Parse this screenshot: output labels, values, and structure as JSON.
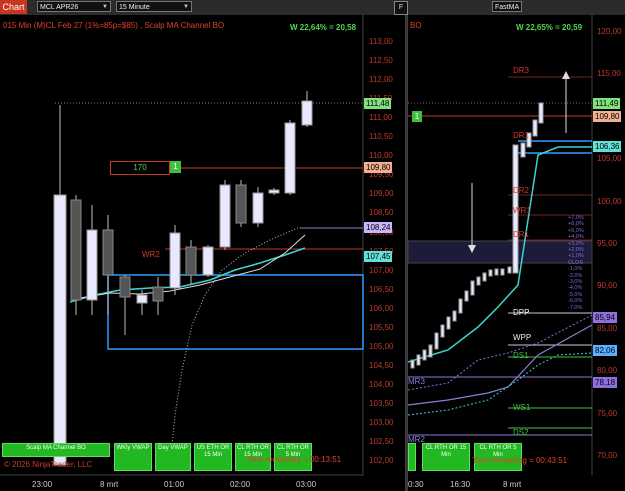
{
  "topbar": {
    "chart_tab": "Chart",
    "instrument": "MCL APR26",
    "interval": "15 Minute",
    "right_tab": "F",
    "right_instrument": "FastMA"
  },
  "left_panel": {
    "title": "015 Min (M)CL Feb 27  (1%=85p=$85) , Scalp MA Channel BO",
    "win_stat": "W 22,64% = 20,58",
    "y_ticks": [
      "113,00",
      "112,50",
      "112,00",
      "111,50",
      "111,00",
      "110,50",
      "110,00",
      "109,50",
      "109,00",
      "108,50",
      "108,00",
      "107,50",
      "107,00",
      "106,50",
      "106,00",
      "105,50",
      "105,00",
      "104,50",
      "104,00",
      "103,50",
      "103,00",
      "102,50",
      "102,00"
    ],
    "price_tags": [
      {
        "value": "111,48",
        "color": "#7fe27f"
      },
      {
        "value": "109,80",
        "color": "#f0b090"
      },
      {
        "value": "108,24",
        "color": "#c9b6ff"
      },
      {
        "value": "107,45",
        "color": "#62e0d8"
      }
    ],
    "order_box": {
      "qty": "170",
      "badge": "1"
    },
    "levels": {
      "wr2": "WR2"
    },
    "x_labels": [
      "23:00",
      "8 mrt",
      "01:00",
      "02:00",
      "03:00"
    ],
    "buttons": [
      {
        "label": "Scalp MA Channel BO"
      },
      {
        "label": "WKly VWAP"
      },
      {
        "label": "Day VWAP"
      },
      {
        "label": "US ETH OR 15 Min"
      },
      {
        "label": "CL RTH OR 15 Min"
      },
      {
        "label": "CL RTH OR 5 Min"
      }
    ],
    "copyright": "© 2026 NinjaTrader, LLC",
    "time_remaining": "Time remaining = 00:13:51"
  },
  "right_panel": {
    "title": "BO",
    "win_stat": "W 22,65% = 20,59",
    "y_ticks": [
      "120,00",
      "115,00",
      "110,00",
      "105,00",
      "100,00",
      "95,00",
      "90,00",
      "85,00",
      "80,00",
      "75,00",
      "70,00"
    ],
    "price_tags": [
      {
        "value": "111,49",
        "color": "#7fe27f"
      },
      {
        "value": "109,80",
        "color": "#f0b090"
      },
      {
        "value": "106,36",
        "color": "#62e0d8"
      },
      {
        "value": "85,94",
        "color": "#8f6ee0"
      },
      {
        "value": "82,06",
        "color": "#5ab0ff"
      },
      {
        "value": "78,18",
        "color": "#8f6ee0"
      }
    ],
    "levels": [
      "DR3",
      "DR2",
      "DR1",
      "WR1",
      "DR1",
      "DPP",
      "WPP",
      "DS1",
      "MR3",
      "WS1",
      "DS2",
      "MR2"
    ],
    "order_badge": "1",
    "pct_scale": "+7,0%\n+6,0%\n+5,0%\n+4,0%\n+3,0%\n+2,0%\n+1,0%\nCLOS\n-1,0%\n-2,0%\n-3,0%\n-4,0%\n-5,0%\n-6,0%\n-7,0%",
    "x_labels": [
      "0:30",
      "16:30",
      "8 mrt"
    ],
    "buttons": [
      {
        "label": "CL RTH OR 15 Min"
      },
      {
        "label": "CL RTH OR 5 Min"
      }
    ],
    "time_remaining": "Time remaining = 00:43:51"
  }
}
